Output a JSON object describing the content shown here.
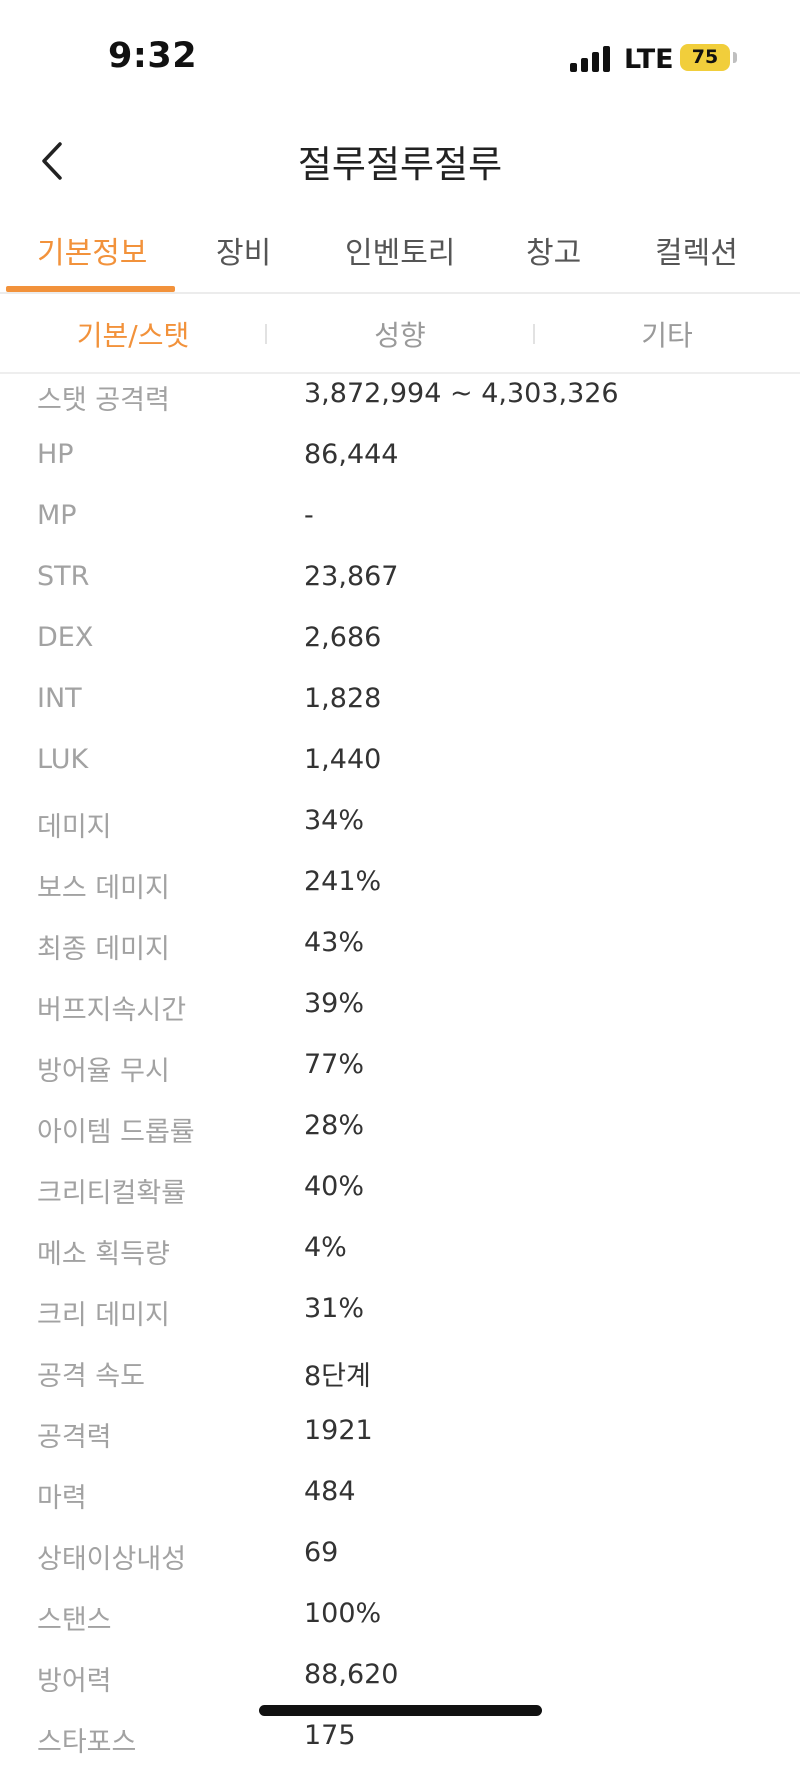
{
  "status_bar": {
    "time": "9:32",
    "network": "LTE",
    "battery": "75",
    "battery_color": "#f1ce3b"
  },
  "header": {
    "back_icon": "chevron-left-icon",
    "title": "절루절루절루"
  },
  "tabs": [
    {
      "label": "기본정보",
      "active": true
    },
    {
      "label": "장비",
      "active": false
    },
    {
      "label": "인벤토리",
      "active": false
    },
    {
      "label": "창고",
      "active": false
    },
    {
      "label": "컬렉션",
      "active": false
    }
  ],
  "subtabs": [
    {
      "label": "기본/스탯",
      "active": true
    },
    {
      "label": "성향",
      "active": false
    },
    {
      "label": "기타",
      "active": false
    }
  ],
  "accent_color": "#f2923b",
  "stats": [
    {
      "label": "스탯 공격력",
      "value": "3,872,994 ~ 4,303,326"
    },
    {
      "label": "HP",
      "value": "86,444"
    },
    {
      "label": "MP",
      "value": "-"
    },
    {
      "label": "STR",
      "value": "23,867"
    },
    {
      "label": "DEX",
      "value": "2,686"
    },
    {
      "label": "INT",
      "value": "1,828"
    },
    {
      "label": "LUK",
      "value": "1,440"
    },
    {
      "label": "데미지",
      "value": "34%"
    },
    {
      "label": "보스 데미지",
      "value": "241%"
    },
    {
      "label": "최종 데미지",
      "value": "43%"
    },
    {
      "label": "버프지속시간",
      "value": "39%"
    },
    {
      "label": "방어율 무시",
      "value": "77%"
    },
    {
      "label": "아이템 드롭률",
      "value": "28%"
    },
    {
      "label": "크리티컬확률",
      "value": "40%"
    },
    {
      "label": "메소 획득량",
      "value": "4%"
    },
    {
      "label": "크리 데미지",
      "value": "31%"
    },
    {
      "label": "공격 속도",
      "value": "8단계"
    },
    {
      "label": "공격력",
      "value": "1921"
    },
    {
      "label": "마력",
      "value": "484"
    },
    {
      "label": "상태이상내성",
      "value": "69"
    },
    {
      "label": "스탠스",
      "value": "100%"
    },
    {
      "label": "방어력",
      "value": "88,620"
    },
    {
      "label": "스타포스",
      "value": "175"
    }
  ]
}
